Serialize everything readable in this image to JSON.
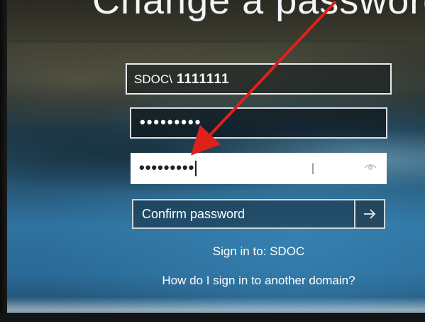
{
  "title": "Change a password",
  "username_field": {
    "domain": "SDOC\\",
    "user": "1111111"
  },
  "old_password_field": {
    "masked_value": "•••••••••"
  },
  "new_password_field": {
    "masked_value": "•••••••••",
    "ibeam": "I"
  },
  "confirm_password": {
    "label": "Confirm password",
    "arrow": "→"
  },
  "sign_in_to": "Sign in to: SDOC",
  "other_domain_link": "How do I sign in to another domain?",
  "annotation": {
    "color": "#e0201a"
  }
}
